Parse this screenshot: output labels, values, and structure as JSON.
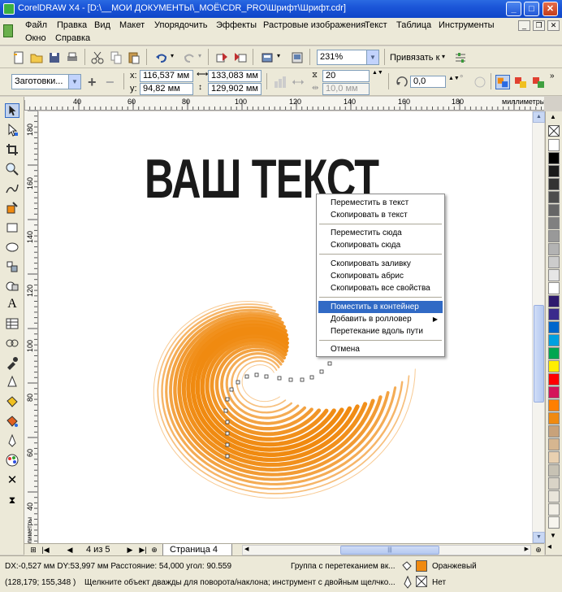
{
  "window": {
    "title": "CorelDRAW X4 - [D:\\__МОИ ДОКУМЕНТЫ\\_МОЁ\\CDR_PRO\\Шрифт\\Шрифт.cdr]",
    "min": "_",
    "max": "□",
    "close": "✕"
  },
  "menu": {
    "row1": [
      "Файл",
      "Правка",
      "Вид",
      "Макет",
      "Упорядочить",
      "Эффекты",
      "Растровые изображения",
      "Текст",
      "Таблица",
      "Инструменты"
    ],
    "row2": [
      "Окно",
      "Справка"
    ]
  },
  "standard_toolbar": {
    "zoom": "231%",
    "snap": "Привязать к"
  },
  "property_bar": {
    "presets": "Заготовки...",
    "x_label": "x:",
    "x": "116,537 мм",
    "y_label": "y:",
    "y": "94,82 мм",
    "width": "133,083 мм",
    "height": "129,902 мм",
    "steps": "20",
    "spacing": "10,0 мм",
    "rotation": "0,0",
    "degree": "°"
  },
  "rulers": {
    "unit": "миллиметры",
    "h_ticks": [
      "40",
      "60",
      "80",
      "100",
      "120",
      "140",
      "160",
      "180"
    ],
    "v_ticks": [
      "180",
      "160",
      "140",
      "120",
      "100",
      "80",
      "60",
      "40"
    ],
    "v_unit": "миллиметры"
  },
  "canvas": {
    "headline": "ВАШ ТЕКСТ",
    "spiral_color": "#f08a10"
  },
  "context_menu": {
    "items": [
      "Переместить в текст",
      "Скопировать в текст",
      "Переместить сюда",
      "Скопировать сюда",
      "Скопировать заливку",
      "Скопировать абрис",
      "Скопировать все свойства",
      "Поместить в контейнер",
      "Добавить в ролловер",
      "Перетекание вдоль пути",
      "Отмена"
    ],
    "highlighted_index": 7,
    "submenu_arrow": "▶"
  },
  "navigation": {
    "page_count": "4 из 5",
    "page_tab": "Страница 4",
    "scroll_grip": "|||"
  },
  "status": {
    "line1": "DX:-0,527 мм DY:53,997 мм Расстояние: 54,000 угол: 90.559",
    "object_info": "Группа с перетеканием вк...",
    "fill_name": "Оранжевый",
    "line2_coords": "(128,179; 155,348 )",
    "line2_hint": "Щелкните объект дважды для поворота/наклона; инструмент с двойным щелчко...",
    "outline_name": "Нет",
    "fill_color": "#f08a10"
  },
  "palette": {
    "colors": [
      "#ffffff",
      "#000000",
      "#1a1a1a",
      "#333333",
      "#4d4d4d",
      "#666666",
      "#808080",
      "#999999",
      "#b3b3b3",
      "#cccccc",
      "#e6e6e6",
      "#ffffff",
      "#2e1a6e",
      "#3a2a8c",
      "#0066cc",
      "#00a0e0",
      "#00a651",
      "#ffee00",
      "#ff0000",
      "#d4145a",
      "#ff7f00",
      "#f08a10",
      "#c8a27a",
      "#d6b690",
      "#e8d0b0",
      "#c7c2b4",
      "#d9d4c7",
      "#e9e5da",
      "#f2efe6",
      "#f7f5ee"
    ]
  }
}
